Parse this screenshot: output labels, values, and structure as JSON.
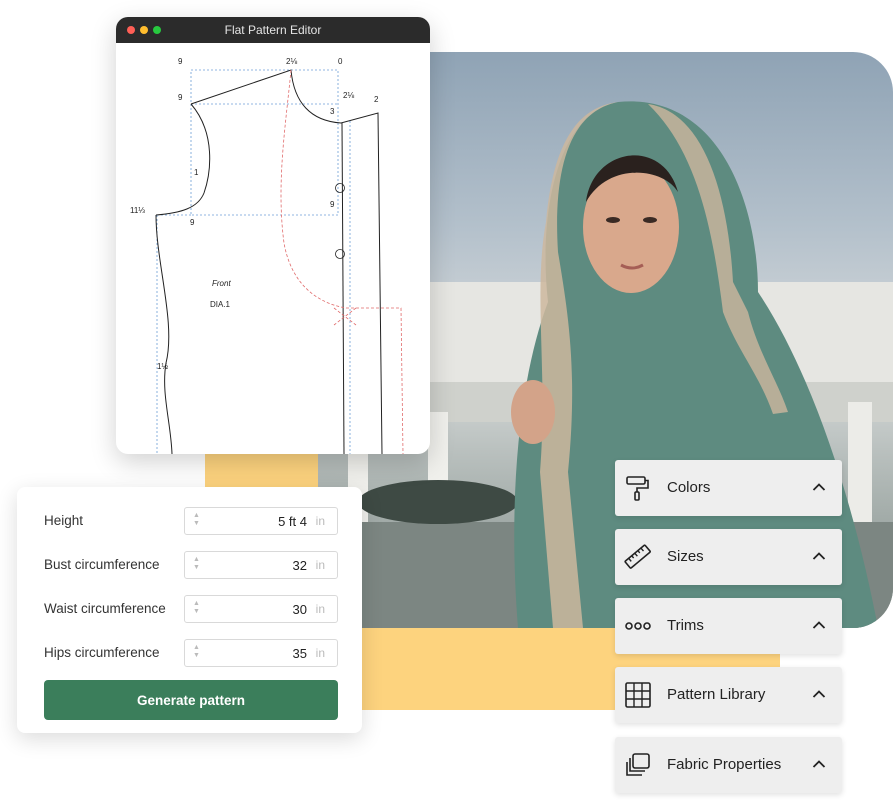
{
  "editor": {
    "title": "Flat Pattern Editor"
  },
  "pattern": {
    "labels": [
      "9",
      "2⅛",
      "0",
      "9",
      "2⅛",
      "2",
      "3",
      "1",
      "9",
      "11⅓",
      "9",
      "Front",
      "DIA.1",
      "1½"
    ]
  },
  "measurements": {
    "rows": [
      {
        "label": "Height",
        "value": "5 ft 4",
        "unit": "in"
      },
      {
        "label": "Bust circumference",
        "value": "32",
        "unit": "in"
      },
      {
        "label": "Waist circumference",
        "value": "30",
        "unit": "in"
      },
      {
        "label": "Hips circumference",
        "value": "35",
        "unit": "in"
      }
    ],
    "button": "Generate pattern"
  },
  "panels": [
    {
      "label": "Colors",
      "icon": "paint-roller-icon"
    },
    {
      "label": "Sizes",
      "icon": "ruler-icon"
    },
    {
      "label": "Trims",
      "icon": "trim-dots-icon"
    },
    {
      "label": "Pattern Library",
      "icon": "grid-icon"
    },
    {
      "label": "Fabric Properties",
      "icon": "layers-icon"
    }
  ],
  "colors": {
    "accent": "#3b7e5b",
    "highlight": "#fdd37e",
    "panel": "#eeeeee"
  }
}
